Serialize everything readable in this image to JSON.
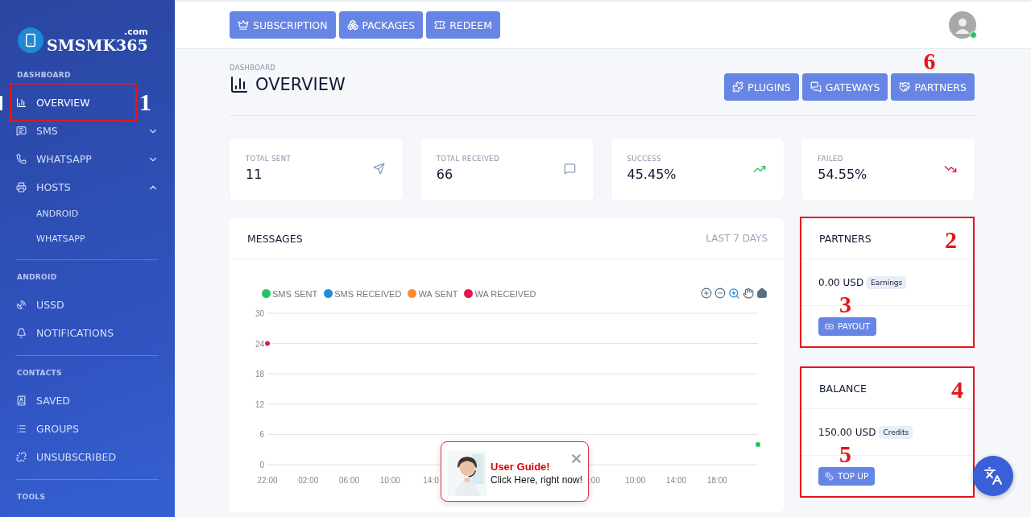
{
  "logo": {
    "name": "SMSMK365",
    "suffix": ".com"
  },
  "sidebar": {
    "sections": [
      {
        "title": "DASHBOARD",
        "items": [
          {
            "label": "OVERVIEW",
            "selected": true,
            "annotation": {
              "label": "1",
              "boxed": true
            }
          },
          {
            "label": "SMS",
            "selected": false,
            "expanded": false
          },
          {
            "label": "WHATSAPP",
            "selected": false,
            "expanded": false
          },
          {
            "label": "HOSTS",
            "selected": false,
            "expanded": true,
            "children": [
              {
                "label": "ANDROID",
                "selected": false
              },
              {
                "label": "WHATSAPP",
                "selected": false
              }
            ]
          }
        ]
      },
      {
        "title": "ANDROID",
        "items": [
          {
            "label": "USSD",
            "selected": false
          },
          {
            "label": "NOTIFICATIONS",
            "selected": false
          }
        ]
      },
      {
        "title": "CONTACTS",
        "items": [
          {
            "label": "SAVED",
            "selected": false
          },
          {
            "label": "GROUPS",
            "selected": false
          },
          {
            "label": "UNSUBSCRIBED",
            "selected": false
          }
        ]
      },
      {
        "title": "TOOLS"
      }
    ]
  },
  "header": {
    "buttons": [
      {
        "label": "SUBSCRIPTION"
      },
      {
        "label": "PACKAGES"
      },
      {
        "label": "REDEEM"
      }
    ],
    "avatar": {
      "online": true
    }
  },
  "page": {
    "breadcrumb": "DASHBOARD",
    "title": "OVERVIEW",
    "actions": [
      {
        "label": "PLUGINS"
      },
      {
        "label": "GATEWAYS"
      },
      {
        "label": "PARTNERS",
        "annotation": {
          "label": "6",
          "boxed": false
        }
      }
    ]
  },
  "stats": [
    {
      "label": "TOTAL SENT",
      "value": "11",
      "kind": "sent"
    },
    {
      "label": "TOTAL RECEIVED",
      "value": "66",
      "kind": "received"
    },
    {
      "label": "SUCCESS",
      "value": "45.45%",
      "kind": "up"
    },
    {
      "label": "FAILED",
      "value": "54.55%",
      "kind": "down"
    }
  ],
  "messages": {
    "title": "MESSAGES",
    "range": "LAST 7 DAYS",
    "chart_data": {
      "type": "line",
      "grid": true,
      "categories": [
        "22:00",
        "02:00",
        "06:00",
        "10:00",
        "14:0",
        null,
        null,
        null,
        ":00",
        "10:00",
        "14:00",
        "18:00",
        null
      ],
      "ylim": [
        0,
        30
      ],
      "yticks": [
        0,
        6,
        12,
        18,
        24,
        30
      ],
      "series": [
        {
          "name": "SMS SENT",
          "color": "#22c55e",
          "marker": true,
          "values": [
            null,
            null,
            null,
            null,
            null,
            null,
            null,
            null,
            null,
            null,
            null,
            null,
            4
          ]
        },
        {
          "name": "SMS RECEIVED",
          "color": "#1e90d6",
          "values": [
            null,
            null,
            null,
            null,
            null,
            null,
            null,
            null,
            null,
            null,
            null,
            null,
            null
          ]
        },
        {
          "name": "WA SENT",
          "color": "#ff8c2e",
          "values": [
            null,
            null,
            null,
            null,
            null,
            null,
            null,
            null,
            null,
            null,
            null,
            null,
            null
          ]
        },
        {
          "name": "WA RECEIVED",
          "color": "#e0194d",
          "marker": true,
          "values": [
            24,
            null,
            null,
            null,
            null,
            null,
            null,
            null,
            null,
            null,
            null,
            null,
            null
          ]
        }
      ]
    },
    "popup": {
      "title": "User Guide!",
      "text": "Click Here, right now!"
    }
  },
  "side_cards": [
    {
      "title": "PARTNERS",
      "amount": "0.00 USD",
      "badge": "Earnings",
      "button": "PAYOUT",
      "kind": "payout",
      "annotation": {
        "label": "2",
        "boxed": true
      },
      "button_annotation": {
        "label": "3",
        "boxed": false
      }
    },
    {
      "title": "BALANCE",
      "amount": "150.00 USD",
      "badge": "Credits",
      "button": "TOP UP",
      "kind": "topup",
      "annotation": {
        "label": "4",
        "boxed": true
      },
      "button_annotation": {
        "label": "5",
        "boxed": false
      }
    }
  ]
}
